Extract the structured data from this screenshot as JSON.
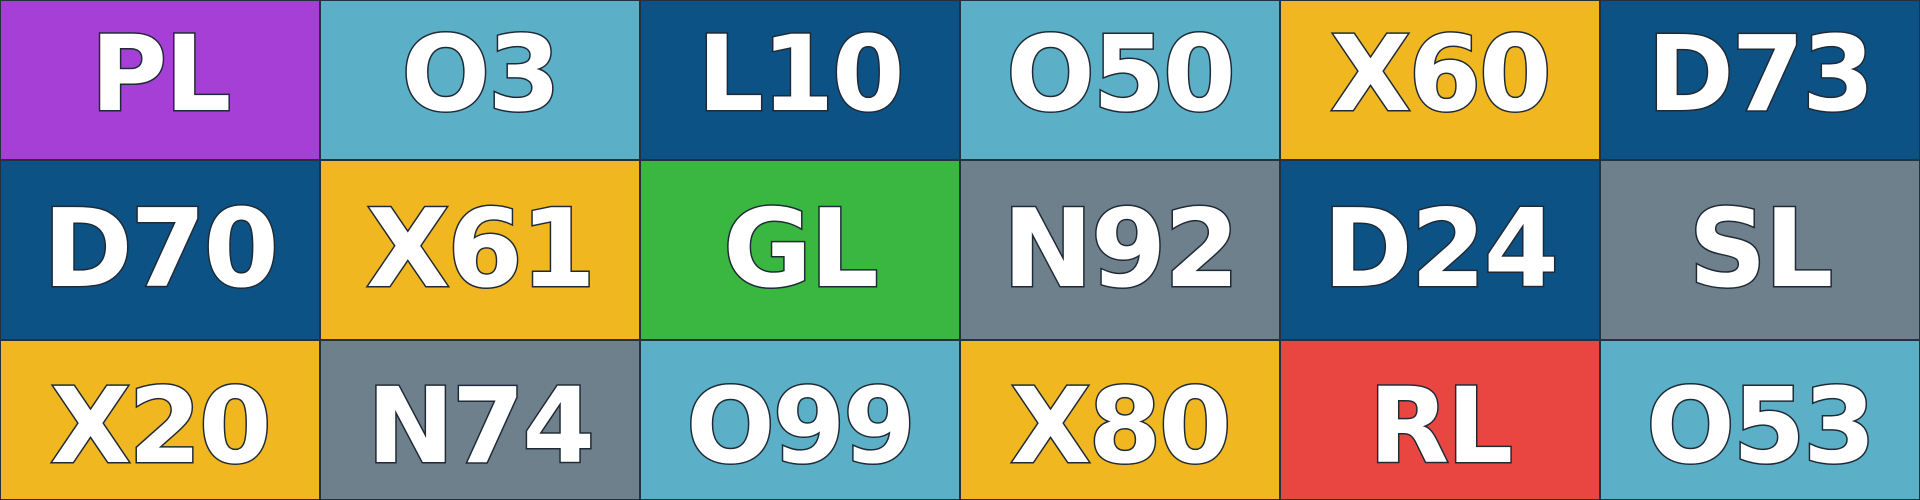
{
  "colors": {
    "purple": "#A53FD5",
    "light_blue": "#5BAFC6",
    "dark_blue": "#0D5284",
    "yellow": "#F1B720",
    "green": "#3AB740",
    "gray": "#6E808C",
    "red": "#EA4641"
  },
  "rows": [
    {
      "tiles": [
        {
          "label": "PL",
          "color": "#A53FD5"
        },
        {
          "label": "O3",
          "color": "#5BAFC6"
        },
        {
          "label": "L10",
          "color": "#0D5284"
        },
        {
          "label": "O50",
          "color": "#5BAFC6"
        },
        {
          "label": "X60",
          "color": "#F1B720"
        },
        {
          "label": "D73",
          "color": "#0D5284"
        }
      ]
    },
    {
      "tiles": [
        {
          "label": "D70",
          "color": "#0D5284"
        },
        {
          "label": "X61",
          "color": "#F1B720"
        },
        {
          "label": "GL",
          "color": "#3AB740"
        },
        {
          "label": "N92",
          "color": "#6E808C"
        },
        {
          "label": "D24",
          "color": "#0D5284"
        },
        {
          "label": "SL",
          "color": "#6E808C"
        }
      ]
    },
    {
      "tiles": [
        {
          "label": "X20",
          "color": "#F1B720"
        },
        {
          "label": "N74",
          "color": "#6E808C"
        },
        {
          "label": "O99",
          "color": "#5BAFC6"
        },
        {
          "label": "X80",
          "color": "#F1B720"
        },
        {
          "label": "RL",
          "color": "#EA4641"
        },
        {
          "label": "O53",
          "color": "#5BAFC6"
        }
      ]
    }
  ]
}
